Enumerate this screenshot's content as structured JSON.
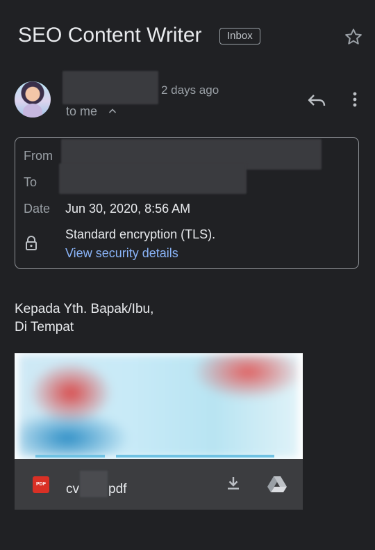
{
  "email": {
    "subject": "SEO Content Writer",
    "label": "Inbox",
    "time": "2 days ago",
    "to_me": "to me",
    "details": {
      "from_label": "From",
      "to_label": "To",
      "date_label": "Date",
      "date_value": "Jun 30, 2020, 8:56 AM",
      "encryption": "Standard encryption (TLS).",
      "security_link": "View security details"
    },
    "body_lines": [
      "Kepada Yth. Bapak/Ibu,",
      "Di Tempat"
    ],
    "attachment": {
      "prefix": "cv",
      "suffix": "pdf",
      "type_badge": "PDF"
    }
  },
  "icons": {
    "star": "star-icon",
    "reply": "reply-icon",
    "more": "more-vert-icon",
    "lock": "lock-icon",
    "download": "download-icon",
    "drive": "drive-icon",
    "chevron": "chevron-up-icon"
  },
  "colors": {
    "background": "#202124",
    "link": "#8ab4f8",
    "pdf_red": "#d93025"
  }
}
